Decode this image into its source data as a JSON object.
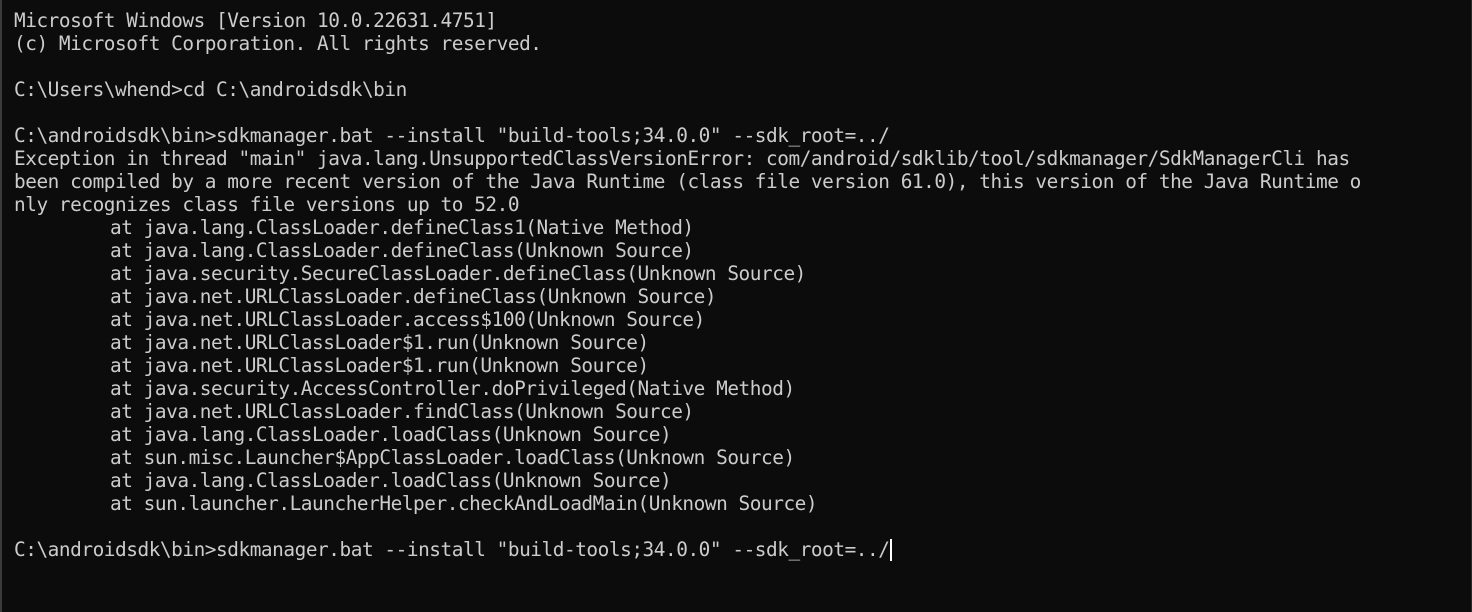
{
  "header": {
    "version_line": "Microsoft Windows [Version 10.0.22631.4751]",
    "copyright_line": "(c) Microsoft Corporation. All rights reserved."
  },
  "session": {
    "cmd_cd": "C:\\Users\\whend>cd C:\\androidsdk\\bin",
    "cmd_sdkmanager": "C:\\androidsdk\\bin>sdkmanager.bat --install \"build-tools;34.0.0\" --sdk_root=../",
    "error_lines": [
      "Exception in thread \"main\" java.lang.UnsupportedClassVersionError: com/android/sdklib/tool/sdkmanager/SdkManagerCli has",
      "been compiled by a more recent version of the Java Runtime (class file version 61.0), this version of the Java Runtime o",
      "nly recognizes class file versions up to 52.0"
    ],
    "stack_trace": [
      "at java.lang.ClassLoader.defineClass1(Native Method)",
      "at java.lang.ClassLoader.defineClass(Unknown Source)",
      "at java.security.SecureClassLoader.defineClass(Unknown Source)",
      "at java.net.URLClassLoader.defineClass(Unknown Source)",
      "at java.net.URLClassLoader.access$100(Unknown Source)",
      "at java.net.URLClassLoader$1.run(Unknown Source)",
      "at java.net.URLClassLoader$1.run(Unknown Source)",
      "at java.security.AccessController.doPrivileged(Native Method)",
      "at java.net.URLClassLoader.findClass(Unknown Source)",
      "at java.lang.ClassLoader.loadClass(Unknown Source)",
      "at sun.misc.Launcher$AppClassLoader.loadClass(Unknown Source)",
      "at java.lang.ClassLoader.loadClass(Unknown Source)",
      "at sun.launcher.LauncherHelper.checkAndLoadMain(Unknown Source)"
    ],
    "current_input": "C:\\androidsdk\\bin>sdkmanager.bat --install \"build-tools;34.0.0\" --sdk_root=../"
  },
  "colors": {
    "background": "#0c0c0c",
    "text": "#cccccc",
    "cursor": "#ffffff"
  }
}
